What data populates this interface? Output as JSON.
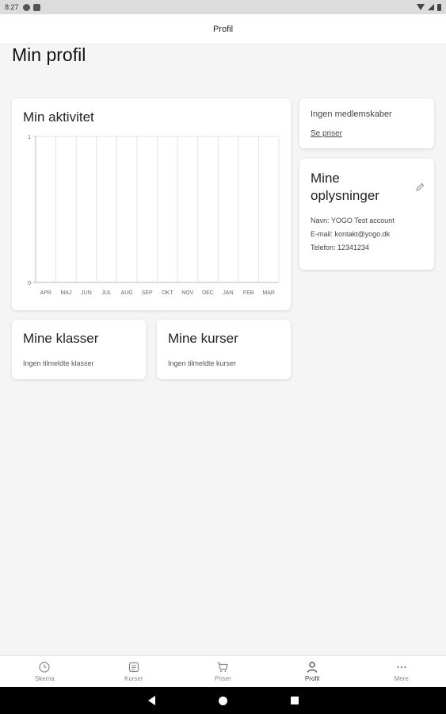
{
  "status_bar": {
    "time": "8:27"
  },
  "app_bar": {
    "title": "Profil"
  },
  "page": {
    "title": "Min profil"
  },
  "activity": {
    "title": "Min aktivitet"
  },
  "chart_data": {
    "type": "bar",
    "title": "Min aktivitet",
    "categories": [
      "APR",
      "MAJ",
      "JUN",
      "JUL",
      "AUG",
      "SEP",
      "OKT",
      "NOV",
      "DEC",
      "JAN",
      "FEB",
      "MAR"
    ],
    "values": [
      0,
      0,
      0,
      0,
      0,
      0,
      0,
      0,
      0,
      0,
      0,
      0
    ],
    "ylim": [
      0,
      1
    ],
    "yticks": [
      "0",
      "1"
    ],
    "grid": true
  },
  "membership": {
    "none_text": "Ingen medlemskaber",
    "link_text": "Se priser"
  },
  "info": {
    "title": "Mine oplysninger",
    "name_line": "Navn: YOGO Test account",
    "email_line": "E-mail: kontakt@yogo.dk",
    "phone_line": "Telefon: 12341234"
  },
  "classes": {
    "title": "Mine klasser",
    "empty": "Ingen tilmeldte klasser"
  },
  "courses": {
    "title": "Mine kurser",
    "empty": "Ingen tilmeldte kurser"
  },
  "nav": {
    "items": [
      {
        "label": "Skema",
        "icon": "clock-icon"
      },
      {
        "label": "Kurser",
        "icon": "list-icon"
      },
      {
        "label": "Priser",
        "icon": "cart-icon"
      },
      {
        "label": "Profil",
        "icon": "person-icon"
      },
      {
        "label": "Mere",
        "icon": "more-icon"
      }
    ]
  }
}
